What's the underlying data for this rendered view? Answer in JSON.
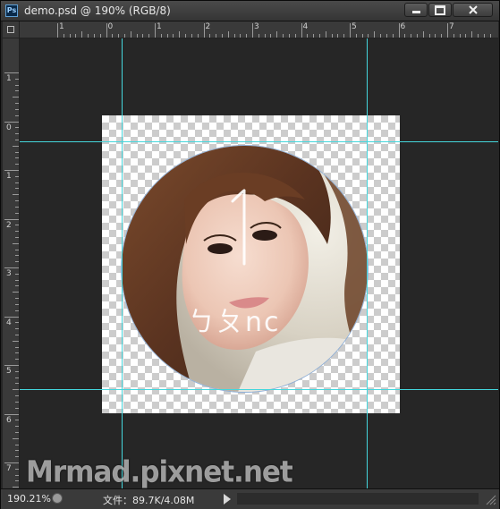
{
  "window": {
    "title": "demo.psd @ 190% (RGB/8)",
    "app_icon_label": "Ps",
    "buttons": {
      "minimize": "minimize-icon",
      "maximize": "maximize-icon",
      "close": "close-icon"
    }
  },
  "rulers": {
    "horizontal_labels": [
      "1",
      "0",
      "1",
      "2",
      "3",
      "4",
      "5",
      "6",
      "7"
    ],
    "vertical_labels": [
      "1",
      "0",
      "1",
      "2",
      "3",
      "4",
      "5",
      "6",
      "7"
    ]
  },
  "document": {
    "name": "demo.psd",
    "zoom": "190%",
    "color_mode": "RGB/8",
    "artwork_text": "ㄅㄆnc",
    "guide_color": "#44d6dc"
  },
  "statusbar": {
    "zoom_value": "190.21%",
    "file_info": "文件：89.7K/4.08M"
  },
  "watermark": "Mrmad.pixnet.net"
}
